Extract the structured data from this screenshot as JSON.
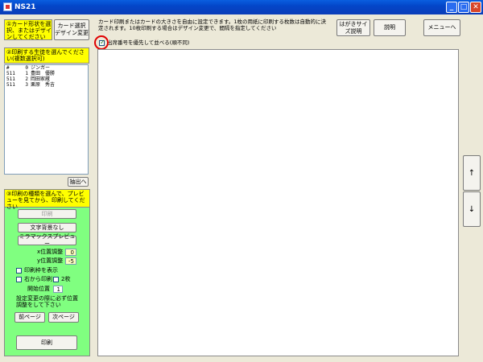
{
  "window": {
    "title": "NS21",
    "minimize": "_",
    "maximize": "□",
    "close": "✕"
  },
  "left_top": {
    "header": "①カード形状を選択、またはデザインしてください",
    "card_select_button": "カード選択\nデザイン変更",
    "prompt": "②印刷する生徒を選んでください(複数選択可)",
    "list": [
      {
        "c1": "#",
        "c2": "0",
        "c3": "ジンガー"
      },
      {
        "c1": "511",
        "c2": "1",
        "c3": "豊田　優勝"
      },
      {
        "c1": "511",
        "c2": "2",
        "c3": "岡田家蔵"
      },
      {
        "c1": "511",
        "c2": "3",
        "c3": "栗原　秀吉"
      }
    ],
    "extract_button": "抽出へ"
  },
  "green_panel": {
    "header": "③印刷の種類を選んで、プレビューを見てから、印刷してください",
    "print_button": "印刷",
    "char_bg_button": "文字背景なし",
    "preview_button": "ミラマックスプレビュー",
    "x_offset_label": "x位置調整",
    "x_offset_value": "0",
    "y_offset_label": "y位置調整",
    "y_offset_value": "-5",
    "frame_checkbox_label": "印刷枠を表示",
    "right_print_label": "右から印刷",
    "two_sheet_label": "2枚",
    "start_pos_label": "開始位置",
    "start_pos_value": "1",
    "note": "設定変更の際に必ず位置調整をして下さい",
    "prev_page_button": "前ページ",
    "next_page_button": "次ページ",
    "print_main_button": "印刷"
  },
  "top": {
    "info": "カード印刷またはカードの大きさを自由に設定できます。1枚の用紙に印刷する枚数は自動的に決定されます。10枚印刷する場合はデザイン変更で、間隔を指定してください",
    "size_button": "はがきサイズ説明",
    "help_button": "説明",
    "menu_button": "メニューへ",
    "checkbox_label": "出席番号を優先して並べる(順不同)"
  },
  "side": {
    "up_button": "↑",
    "down_button": "↓"
  }
}
